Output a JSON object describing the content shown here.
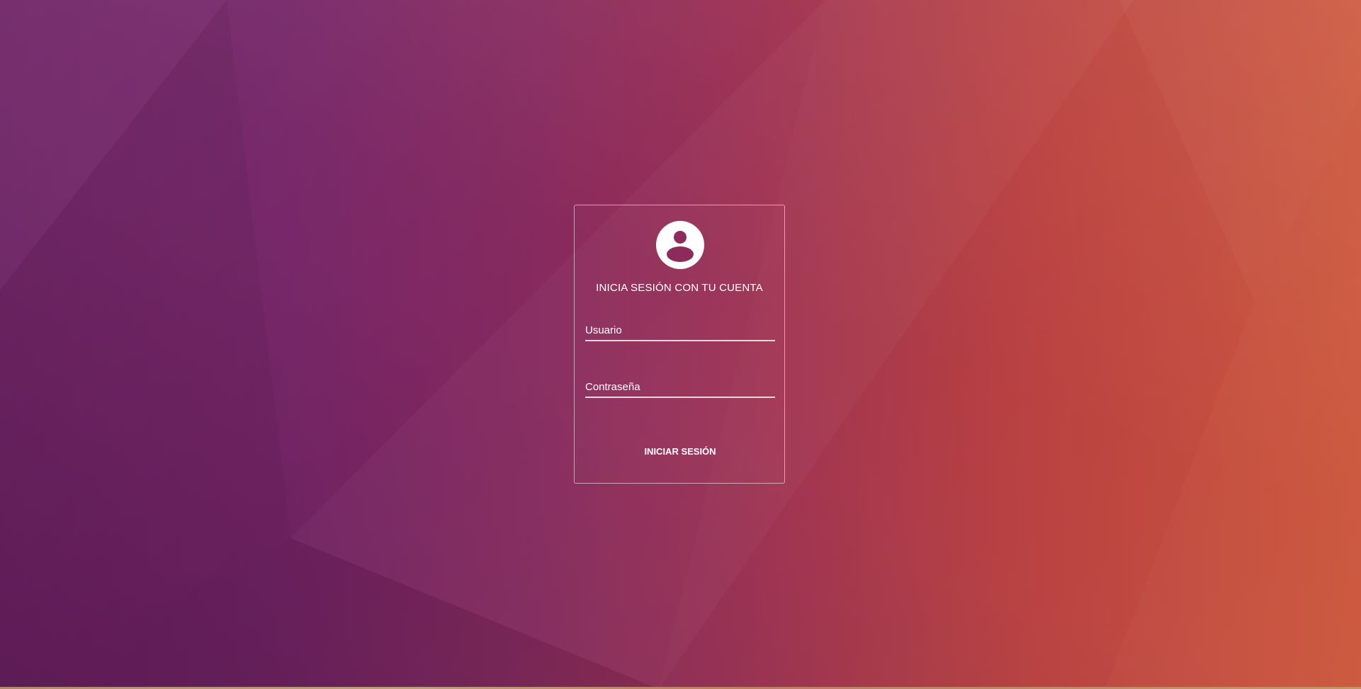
{
  "login": {
    "heading": "INICIA SESIÓN CON TU CUENTA",
    "username_placeholder": "Usuario",
    "password_placeholder": "Contraseña",
    "submit_label": "INICIAR SESIÓN"
  },
  "icons": {
    "avatar": "user-circle-icon"
  },
  "colors": {
    "background_left": "#6c1f63",
    "background_right": "#c94c30",
    "card_border": "#d8c0d0",
    "text": "#ffffff"
  }
}
